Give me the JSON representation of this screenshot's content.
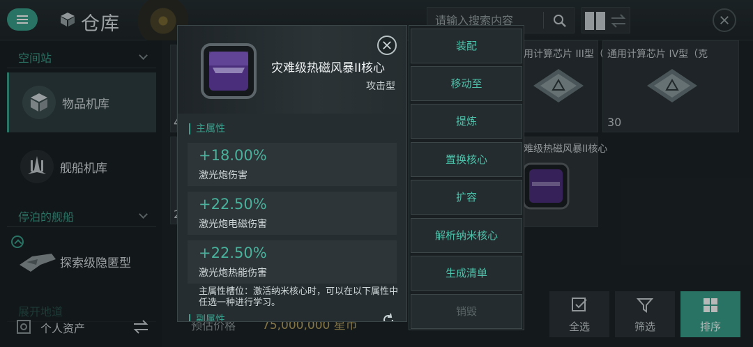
{
  "header": {
    "title": "仓库",
    "search_placeholder": "请输入搜索内容"
  },
  "sidebar": {
    "sections": [
      {
        "label": "空间站"
      },
      {
        "label": "停泊的舰船"
      },
      {
        "label": "展开地道"
      }
    ],
    "items": [
      {
        "label": "物品机库",
        "active": true
      },
      {
        "label": "舰船机库",
        "active": false
      },
      {
        "label": "探索级隐匿型",
        "active": false
      }
    ],
    "personal_assets": "个人资产"
  },
  "grid": {
    "cards": [
      {
        "name": "通用计算芯片 III型（克",
        "quantity": "",
        "icon": "chip-icon"
      },
      {
        "name": "通用计算芯片 IV型（克",
        "quantity": "30",
        "icon": "chip-icon"
      },
      {
        "name": "灾难级热磁风暴II核心",
        "quantity": "",
        "icon": "core-icon"
      }
    ],
    "partial_left_labels": [
      "4",
      "2"
    ]
  },
  "bottom_bar": {
    "price_label": "预估价格",
    "price_value": "75,000,000 星币",
    "buttons": [
      {
        "label": "全选",
        "icon": "select-all-icon"
      },
      {
        "label": "筛选",
        "icon": "filter-icon"
      },
      {
        "label": "排序",
        "icon": "sort-icon",
        "active": true
      }
    ]
  },
  "detail": {
    "name": "灾难级热磁风暴II核心",
    "type": "攻击型",
    "main_attr_header": "主属性",
    "attributes": [
      {
        "value": "+18.00%",
        "desc": "激光炮伤害"
      },
      {
        "value": "+22.50%",
        "desc": "激光炮电磁伤害"
      },
      {
        "value": "+22.50%",
        "desc": "激光炮热能伤害"
      }
    ],
    "slot_note": "主属性槽位：激活纳米核心时，可以在以下属性中任选一种进行学习。",
    "sub_attr_header": "副属性"
  },
  "actions": [
    {
      "label": "装配",
      "enabled": true
    },
    {
      "label": "移动至",
      "enabled": true
    },
    {
      "label": "提炼",
      "enabled": true
    },
    {
      "label": "置换核心",
      "enabled": true
    },
    {
      "label": "扩容",
      "enabled": true
    },
    {
      "label": "解析纳米核心",
      "enabled": true
    },
    {
      "label": "生成清单",
      "enabled": true
    },
    {
      "label": "销毁",
      "enabled": false
    }
  ],
  "colors": {
    "accent": "#3aa08d",
    "accent_text": "#4fc2ab",
    "price": "#b8a361",
    "core_purple": "#5b3a8e"
  }
}
